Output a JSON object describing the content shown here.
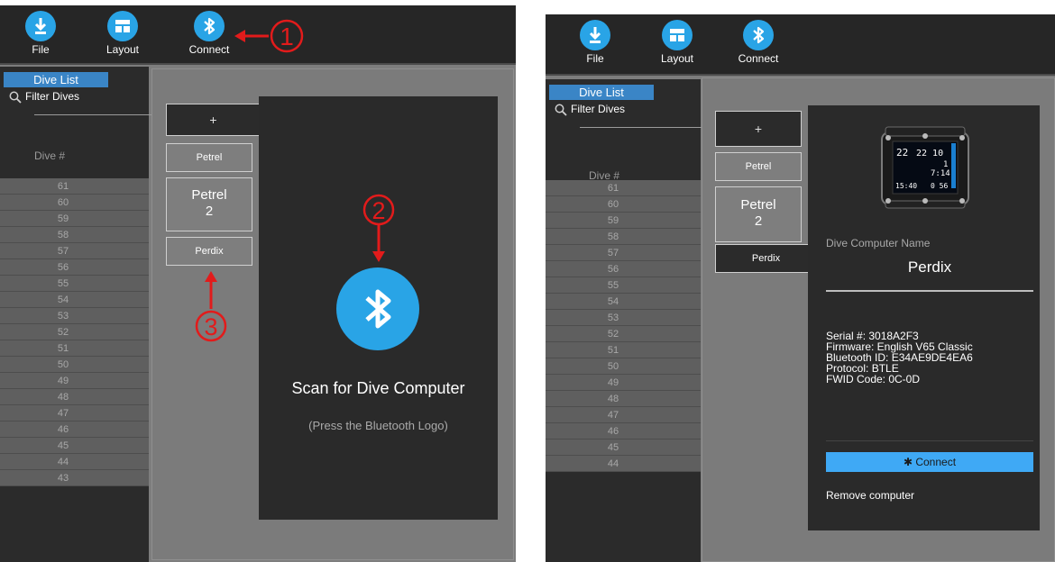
{
  "toolbar": {
    "file_label": "File",
    "layout_label": "Layout",
    "connect_label": "Connect"
  },
  "dive_list": {
    "tab_label": "Dive List",
    "filter_label": "Filter Dives",
    "column_header": "Dive #",
    "rows_left": [
      "61",
      "60",
      "59",
      "58",
      "57",
      "56",
      "55",
      "54",
      "53",
      "52",
      "51",
      "50",
      "49",
      "48",
      "47",
      "46",
      "45",
      "44",
      "43"
    ],
    "rows_right": [
      "61",
      "60",
      "59",
      "58",
      "57",
      "56",
      "55",
      "54",
      "53",
      "52",
      "51",
      "50",
      "49",
      "48",
      "47",
      "46",
      "45",
      "44"
    ]
  },
  "computers": {
    "add_label": "+",
    "petrel_label": "Petrel",
    "petrel2_line1": "Petrel",
    "petrel2_line2": "2",
    "perdix_label": "Perdix"
  },
  "scan": {
    "title": "Scan for Dive Computer",
    "hint": "(Press the Bluetooth Logo)"
  },
  "detail": {
    "name_label": "Dive Computer Name",
    "name_value": "Perdix",
    "serial": "Serial #: 3018A2F3",
    "firmware": "Firmware: English V65 Classic",
    "bluetooth_id": "Bluetooth ID: E34AE9DE4EA6",
    "protocol": "Protocol: BTLE",
    "fwid": "FWID Code: 0C-0D",
    "connect_button": "✱ Connect",
    "remove_label": "Remove computer",
    "device_screen": {
      "line1": "22",
      "line2": "22 10",
      "line3": "1",
      "line4": "7:14",
      "line5": "15:40",
      "line6": "0  56"
    }
  },
  "annotations": {
    "step1": "1",
    "step2": "2",
    "step3": "3"
  },
  "colors": {
    "accent": "#29a4e6",
    "annotation": "#e21b1b",
    "connect_button": "#3fa9f5"
  }
}
